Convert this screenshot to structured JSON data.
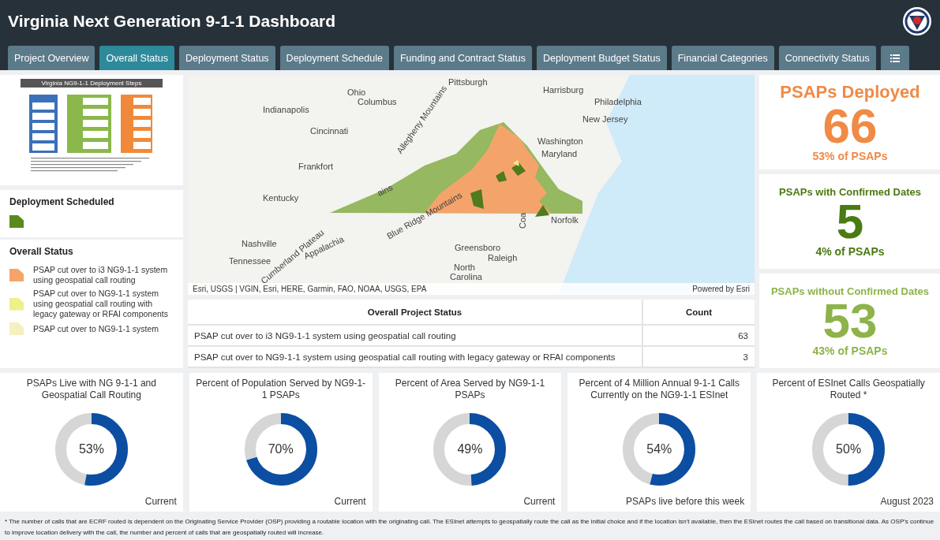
{
  "header": {
    "title": "Virginia Next Generation 9-1-1 Dashboard"
  },
  "tabs": [
    {
      "label": "Project Overview",
      "selected": false
    },
    {
      "label": "Overall Status",
      "selected": true
    },
    {
      "label": "Deployment Status",
      "selected": false
    },
    {
      "label": "Deployment Schedule",
      "selected": false
    },
    {
      "label": "Funding and Contract Status",
      "selected": false
    },
    {
      "label": "Deployment Budget Status",
      "selected": false
    },
    {
      "label": "Financial Categories",
      "selected": false
    },
    {
      "label": "Connectivity Status",
      "selected": false
    }
  ],
  "thumbnail": {
    "title": "Virginia NG9-1-1 Deployment Steps"
  },
  "legend": [
    {
      "title": "Deployment Scheduled",
      "items": [
        {
          "color": "#5a8a1e"
        }
      ]
    },
    {
      "title": "Overall Status",
      "items": [
        {
          "label": "PSAP cut over to i3 NG9-1-1 system using geospatial call routing",
          "color": "#f4a46a"
        },
        {
          "label": "PSAP cut over to NG9-1-1 system using geospatial call routing with legacy gateway or RFAI components",
          "color": "#eef08a"
        },
        {
          "label": "PSAP cut over to NG9-1-1 system",
          "color": "#f5f0c0"
        }
      ]
    }
  ],
  "map": {
    "labels": [
      "Pittsburgh",
      "Harrisburg",
      "Philadelphia",
      "Ohio",
      "Columbus",
      "Indianapolis",
      "New Jersey",
      "Cincinnati",
      "Washington",
      "Maryland",
      "Frankfort",
      "Allegheny Mountains",
      "Kentucky",
      "ains",
      "Appalachia",
      "Cumberland Plateau",
      "Nashville",
      "Tennessee",
      "Blue Ridge Mountains",
      "Greensboro",
      "Raleigh",
      "North",
      "Carolina",
      "Norfolk",
      "Coa"
    ],
    "attribution": "Esri, USGS | VGIN, Esri, HERE, Garmin, FAO, NOAA, USGS, EPA",
    "powered_by": "Powered by Esri"
  },
  "table": {
    "columns": [
      "Overall Project Status",
      "Count"
    ],
    "rows": [
      [
        "PSAP cut over to i3 NG9-1-1 system using geospatial call routing",
        "63"
      ],
      [
        "PSAP cut over to NG9-1-1 system using geospatial call routing with legacy gateway or RFAI components",
        "3"
      ]
    ]
  },
  "kpis": [
    {
      "title": "PSAPs Deployed",
      "value": "66",
      "subtitle": "53% of PSAPs",
      "color": "#f08a45"
    },
    {
      "title": "PSAPs with Confirmed Dates",
      "value": "5",
      "subtitle": "4% of PSAPs",
      "color": "#4a7a12"
    },
    {
      "title": "PSAPs without Confirmed Dates",
      "value": "53",
      "subtitle": "43% of PSAPs",
      "color": "#8db34a"
    }
  ],
  "gauges": [
    {
      "title": "PSAPs Live with NG 9-1-1 and Geospatial Call Routing",
      "value": "53%",
      "level": 0.53,
      "footer": "Current"
    },
    {
      "title": "Percent of Population Served by NG9-1-1 PSAPs",
      "value": "70%",
      "level": 0.7,
      "footer": "Current"
    },
    {
      "title": "Percent of Area Served by NG9-1-1 PSAPs",
      "value": "49%",
      "level": 0.49,
      "footer": "Current"
    },
    {
      "title": "Percent of 4 Million Annual 9-1-1 Calls Currently on the NG9-1-1 ESInet",
      "value": "54%",
      "level": 0.54,
      "footer": "PSAPs live before this week"
    },
    {
      "title": "Percent of ESInet Calls Geospatially Routed *",
      "value": "50%",
      "level": 0.5,
      "footer": "August 2023"
    }
  ],
  "footnote": "* The number of calls that are ECRF routed is dependent on the Originating Service Provider (OSP) providing a routable location with the originating call.  The ESInet attempts to geospatially route the call as the initial choice and if the location isn't available, then the ESInet routes the call based on transitional data.  As OSP's continue to improve location delivery with the call, the number and percent of calls that are geospatially routed will increase."
}
